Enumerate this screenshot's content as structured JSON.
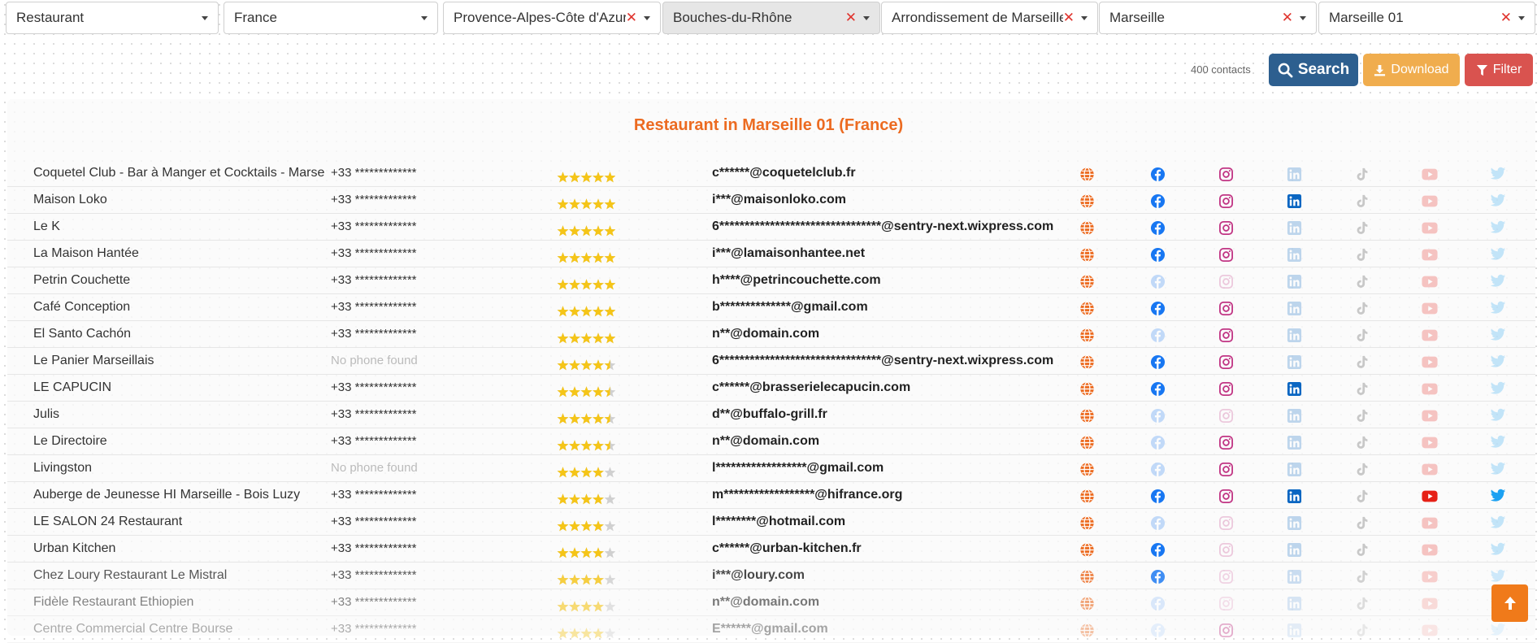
{
  "filters": [
    {
      "label": "Restaurant",
      "clear": false
    },
    {
      "label": "France",
      "clear": false
    },
    {
      "label": "Provence-Alpes-Côte d'Azur",
      "clear": true
    },
    {
      "label": "Bouches-du-Rhône",
      "clear": true,
      "active": true
    },
    {
      "label": "Arrondissement de Marseille",
      "clear": true
    },
    {
      "label": "Marseille",
      "clear": true
    },
    {
      "label": "Marseille 01",
      "clear": true
    }
  ],
  "toolbar": {
    "count_label": "400 contacts",
    "search_label": "Search",
    "download_label": "Download",
    "filter_label": "Filter"
  },
  "results_title": "Restaurant in Marseille 01 (France)",
  "colors": {
    "accent": "#ec6b21",
    "search": "#2d5f8f",
    "download": "#f0ad4e",
    "filter": "#d9534f",
    "facebook": "#1877f2",
    "instagram": "#c13584",
    "linkedin": "#0a66c2",
    "youtube": "#e62117",
    "twitter": "#1da1f2",
    "tiktok": "#333333",
    "star": "#f5c518"
  },
  "contacts": [
    {
      "name": "Coquetel Club - Bar à Manger et Cocktails - Marse",
      "phone": "+33 *************",
      "rating": 5,
      "email": "c******@coquetelclub.fr",
      "social": {
        "web": true,
        "fb": true,
        "ig": true,
        "li": false,
        "tt": false,
        "yt": false,
        "tw": false
      }
    },
    {
      "name": "Maison Loko",
      "phone": "+33 *************",
      "rating": 5,
      "email": "i***@maisonloko.com",
      "social": {
        "web": true,
        "fb": true,
        "ig": true,
        "li": true,
        "tt": false,
        "yt": false,
        "tw": false
      }
    },
    {
      "name": "Le K",
      "phone": "+33 *************",
      "rating": 5,
      "email": "6********************************@sentry-next.wixpress.com",
      "social": {
        "web": true,
        "fb": true,
        "ig": true,
        "li": false,
        "tt": false,
        "yt": false,
        "tw": false
      }
    },
    {
      "name": "La Maison Hantée",
      "phone": "+33 *************",
      "rating": 5,
      "email": "i***@lamaisonhantee.net",
      "social": {
        "web": true,
        "fb": true,
        "ig": true,
        "li": false,
        "tt": false,
        "yt": false,
        "tw": false
      }
    },
    {
      "name": "Petrin Couchette",
      "phone": "+33 *************",
      "rating": 5,
      "email": "h****@petrincouchette.com",
      "social": {
        "web": true,
        "fb": false,
        "ig": false,
        "li": false,
        "tt": false,
        "yt": false,
        "tw": false
      }
    },
    {
      "name": "Café Conception",
      "phone": "+33 *************",
      "rating": 5,
      "email": "b**************@gmail.com",
      "social": {
        "web": true,
        "fb": true,
        "ig": true,
        "li": false,
        "tt": false,
        "yt": false,
        "tw": false
      }
    },
    {
      "name": "El Santo Cachón",
      "phone": "+33 *************",
      "rating": 5,
      "email": "n**@domain.com",
      "social": {
        "web": true,
        "fb": false,
        "ig": true,
        "li": false,
        "tt": false,
        "yt": false,
        "tw": false
      }
    },
    {
      "name": "Le Panier Marseillais",
      "phone": "No phone found",
      "rating": 4.5,
      "email": "6********************************@sentry-next.wixpress.com",
      "social": {
        "web": true,
        "fb": true,
        "ig": true,
        "li": false,
        "tt": false,
        "yt": false,
        "tw": false
      }
    },
    {
      "name": "LE CAPUCIN",
      "phone": "+33 *************",
      "rating": 4.5,
      "email": "c******@brasserielecapucin.com",
      "social": {
        "web": true,
        "fb": true,
        "ig": true,
        "li": true,
        "tt": false,
        "yt": false,
        "tw": false
      }
    },
    {
      "name": "Julis",
      "phone": "+33 *************",
      "rating": 4.5,
      "email": "d**@buffalo-grill.fr",
      "social": {
        "web": true,
        "fb": false,
        "ig": false,
        "li": false,
        "tt": false,
        "yt": false,
        "tw": false
      }
    },
    {
      "name": "Le Directoire",
      "phone": "+33 *************",
      "rating": 4.5,
      "email": "n**@domain.com",
      "social": {
        "web": true,
        "fb": false,
        "ig": true,
        "li": false,
        "tt": false,
        "yt": false,
        "tw": false
      }
    },
    {
      "name": "Livingston",
      "phone": "No phone found",
      "rating": 4,
      "email": "l******************@gmail.com",
      "social": {
        "web": true,
        "fb": false,
        "ig": true,
        "li": false,
        "tt": false,
        "yt": false,
        "tw": false
      }
    },
    {
      "name": "Auberge de Jeunesse HI Marseille - Bois Luzy",
      "phone": "+33 *************",
      "rating": 4,
      "email": "m******************@hifrance.org",
      "social": {
        "web": true,
        "fb": true,
        "ig": true,
        "li": true,
        "tt": false,
        "yt": true,
        "tw": true
      }
    },
    {
      "name": "LE SALON 24 Restaurant",
      "phone": "+33 *************",
      "rating": 4,
      "email": "l********@hotmail.com",
      "social": {
        "web": true,
        "fb": false,
        "ig": false,
        "li": false,
        "tt": false,
        "yt": false,
        "tw": false
      }
    },
    {
      "name": "Urban Kitchen",
      "phone": "+33 *************",
      "rating": 4,
      "email": "c******@urban-kitchen.fr",
      "social": {
        "web": true,
        "fb": true,
        "ig": false,
        "li": false,
        "tt": false,
        "yt": false,
        "tw": false
      }
    },
    {
      "name": "Chez Loury Restaurant Le Mistral",
      "phone": "+33 *************",
      "rating": 4,
      "email": "i***@loury.com",
      "social": {
        "web": true,
        "fb": true,
        "ig": false,
        "li": false,
        "tt": false,
        "yt": false,
        "tw": false
      }
    },
    {
      "name": "Fidèle Restaurant Ethiopien",
      "phone": "+33 *************",
      "rating": 4,
      "email": "n**@domain.com",
      "social": {
        "web": true,
        "fb": false,
        "ig": false,
        "li": false,
        "tt": false,
        "yt": false,
        "tw": false
      }
    },
    {
      "name": "Centre Commercial Centre Bourse",
      "phone": "+33 *************",
      "rating": 4,
      "email": "E******@gmail.com",
      "social": {
        "web": true,
        "fb": false,
        "ig": true,
        "li": false,
        "tt": false,
        "yt": false,
        "tw": false
      }
    }
  ]
}
